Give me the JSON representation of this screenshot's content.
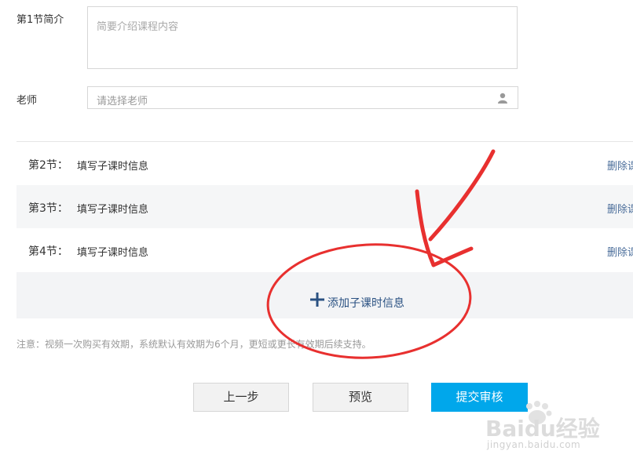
{
  "form": {
    "intro_label": "第1节简介",
    "intro_placeholder": "简要介绍课程内容",
    "teacher_label": "老师",
    "teacher_placeholder": "请选择老师",
    "teacher_icon": "user-icon"
  },
  "lessons": [
    {
      "number": "第2节：",
      "info": "填写子课时信息",
      "delete": "删除课时"
    },
    {
      "number": "第3节：",
      "info": "填写子课时信息",
      "delete": "删除课时"
    },
    {
      "number": "第4节：",
      "info": "填写子课时信息",
      "delete": "删除课时"
    }
  ],
  "add_lesson": {
    "label": "添加子课时信息",
    "icon": "plus-icon"
  },
  "note": "注意：视频一次购买有效期，系统默认有效期为6个月，更短或更长有效期后续支持。",
  "buttons": {
    "prev": "上一步",
    "preview": "预览",
    "submit": "提交审核"
  },
  "watermark": {
    "brand": "Baidu经验",
    "url": "jingyan.baidu.com"
  },
  "colors": {
    "primary": "#00a7eb",
    "link": "#4a6d9a",
    "annotation": "#e8302f"
  }
}
